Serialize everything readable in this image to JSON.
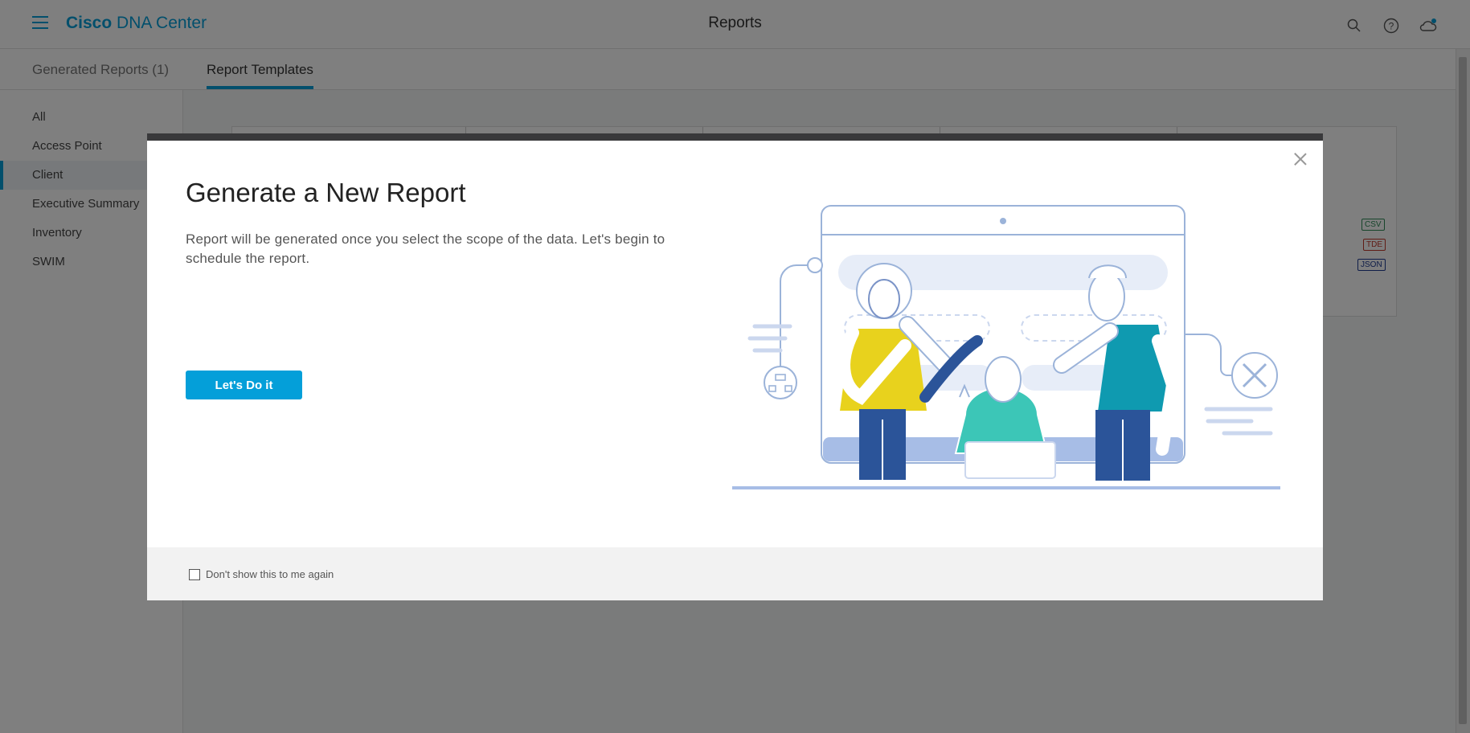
{
  "app": {
    "brand_bold": "Cisco",
    "brand_rest": " DNA Center",
    "page_title": "Reports",
    "accent": "#049fd9"
  },
  "header_icons": [
    "search-icon",
    "help-icon",
    "cloud-notification-icon"
  ],
  "tabs": [
    {
      "label": "Generated Reports (1)",
      "active": false
    },
    {
      "label": "Report Templates",
      "active": true
    }
  ],
  "sidebar": {
    "items": [
      {
        "label": "All",
        "active": false
      },
      {
        "label": "Access Point",
        "active": false
      },
      {
        "label": "Client",
        "active": true
      },
      {
        "label": "Executive Summary",
        "active": false
      },
      {
        "label": "Inventory",
        "active": false
      },
      {
        "label": "SWIM",
        "active": false
      }
    ]
  },
  "formats": [
    "CSV",
    "TDE",
    "JSON"
  ],
  "modal": {
    "title": "Generate a New Report",
    "description": "Report will be generated once you select the scope of the data. Let's begin to schedule the report.",
    "cta_label": "Let's Do it",
    "dont_show_label": "Don't show this to me again",
    "dont_show_checked": false
  }
}
